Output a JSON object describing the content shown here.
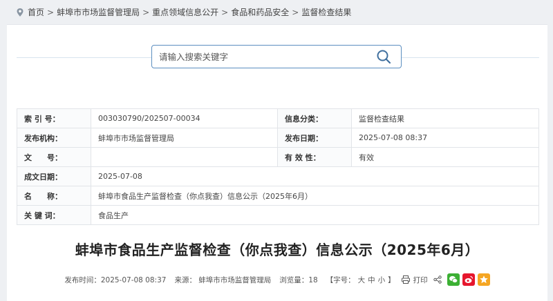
{
  "breadcrumb": {
    "home": "首页",
    "items": [
      "蚌埠市市场监督管理局",
      "重点领域信息公开",
      "食品和药品安全",
      "监督检查结果"
    ],
    "separator": ">"
  },
  "search": {
    "placeholder": "请输入搜索关键字"
  },
  "meta": {
    "index_label": "索 引 号：",
    "index_value": "003030790/202507-00034",
    "category_label": "信息分类：",
    "category_value": "监督检查结果",
    "publisher_label": "发布机构：",
    "publisher_value": "蚌埠市市场监督管理局",
    "pubdate_label": "发布日期：",
    "pubdate_value": "2025-07-08 08:37",
    "docno_label": "文　　号：",
    "docno_value": "",
    "validity_label": "有 效 性：",
    "validity_value": "有效",
    "created_label": "成文日期：",
    "created_value": "2025-07-08",
    "name_label": "名　　称：",
    "name_value": "蚌埠市食品生产监督检查（你点我查）信息公示（2025年6月）",
    "keywords_label": "关 键 词：",
    "keywords_value": "食品生产"
  },
  "article": {
    "title": "蚌埠市食品生产监督检查（你点我查）信息公示（2025年6月）",
    "publish_time": "发布时间：2025-07-08 08:37",
    "source": "来源： 蚌埠市市场监督管理局",
    "views": "浏览量：18",
    "font_size_open": "【字号：",
    "font_large": "大",
    "font_medium": "中",
    "font_small": "小",
    "font_size_close": "】",
    "print": "打印"
  },
  "colors": {
    "accent": "#5b8ec0",
    "wechat": "#3cb034",
    "weibo": "#e6162d",
    "favorite": "#f5a623"
  }
}
